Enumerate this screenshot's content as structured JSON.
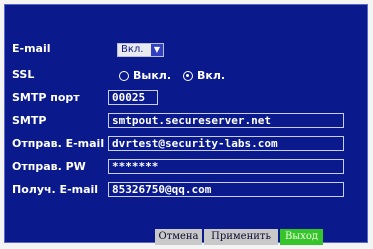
{
  "email": {
    "label": "E-mail",
    "value": "Вкл."
  },
  "ssl": {
    "label": "SSL",
    "off_label": "Выкл.",
    "on_label": "Вкл.",
    "selected": "on"
  },
  "smtp_port": {
    "label": "SMTP порт",
    "value": "00025"
  },
  "smtp": {
    "label": "SMTP",
    "value": "smtpout.secureserver.net"
  },
  "sender_email": {
    "label": "Отправ. E-mail",
    "value": "dvrtest@security-labs.com"
  },
  "sender_pw": {
    "label": "Отправ.  PW",
    "value": "*******"
  },
  "recipient_email": {
    "label": "Получ. E-mail",
    "value": "85326750@qq.com"
  },
  "buttons": {
    "cancel": "Отмена",
    "apply": "Применить",
    "exit": "Выход"
  },
  "colors": {
    "background": "#0a1a8c",
    "exit_button": "#35c52a"
  },
  "icons": {
    "dropdown": "chevron-down-icon"
  }
}
